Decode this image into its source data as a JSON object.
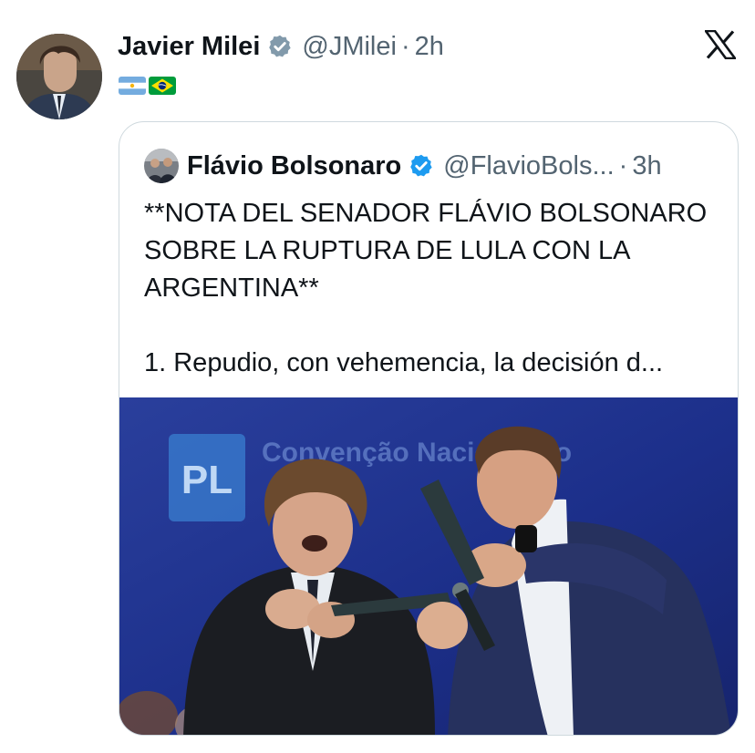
{
  "tweet": {
    "author_name": "Javier Milei",
    "handle": "@JMilei",
    "separator": "·",
    "time": "2h",
    "icons": {
      "verified": "verified-badge-icon",
      "platform": "x-logo-icon",
      "flags": [
        "argentina-flag-icon",
        "brazil-flag-icon"
      ]
    }
  },
  "quote": {
    "author_name": "Flávio Bolsonaro",
    "handle": "@FlavioBols...",
    "separator": "·",
    "time": "3h",
    "text_line1": "**NOTA DEL SENADOR FLÁVIO BOLSONARO SOBRE LA RUPTURA DE LULA CON LA ARGENTINA**",
    "text_line2": "1. Repudio, con vehemencia, la decisión d...",
    "image": {
      "sign_logo": "PL",
      "sign_text": "Convenção Nacional do"
    }
  },
  "colors": {
    "text_primary": "#0f1419",
    "text_secondary": "#536471",
    "verified_blue": "#1d9bf0",
    "verified_gray": "#829aab",
    "border": "#cfd9de",
    "photo_background": "#1c2f8a"
  }
}
